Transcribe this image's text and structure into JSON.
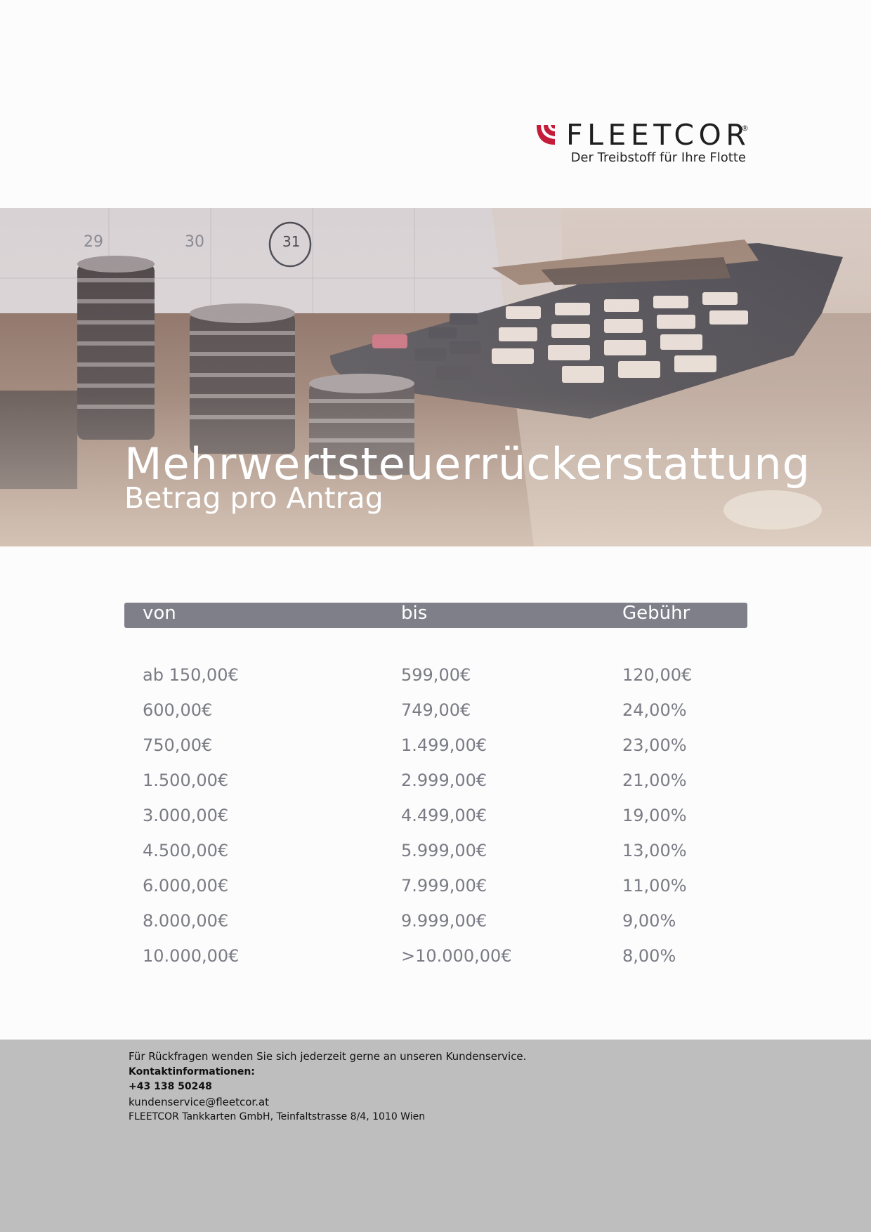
{
  "brand": {
    "name": "FLEETCOR",
    "registered_mark": "®",
    "tagline": "Der Treibstoff für Ihre Flotte",
    "accent_color": "#c31d3a"
  },
  "hero": {
    "title": "Mehrwertsteuerrückerstattung",
    "subtitle": "Betrag pro Antrag",
    "calendar_numbers": [
      "29",
      "30",
      "31"
    ]
  },
  "table": {
    "headers": {
      "from": "von",
      "to": "bis",
      "fee": "Gebühr"
    },
    "header_color": "#7e7f89",
    "rows": [
      {
        "from": "ab 150,00€",
        "to": "599,00€",
        "fee": "120,00€"
      },
      {
        "from": "600,00€",
        "to": "749,00€",
        "fee": "24,00%"
      },
      {
        "from": "750,00€",
        "to": "1.499,00€",
        "fee": "23,00%"
      },
      {
        "from": "1.500,00€",
        "to": "2.999,00€",
        "fee": "21,00%"
      },
      {
        "from": "3.000,00€",
        "to": "4.499,00€",
        "fee": "19,00%"
      },
      {
        "from": "4.500,00€",
        "to": "5.999,00€",
        "fee": "13,00%"
      },
      {
        "from": "6.000,00€",
        "to": "7.999,00€",
        "fee": "11,00%"
      },
      {
        "from": "8.000,00€",
        "to": "9.999,00€",
        "fee": "9,00%"
      },
      {
        "from": "10.000,00€",
        "to": ">10.000,00€",
        "fee": "8,00%"
      }
    ]
  },
  "footer": {
    "intro": "Für Rückfragen wenden Sie sich jederzeit gerne an unseren Kundenservice.",
    "contact_heading": "Kontaktinformationen:",
    "phone": "+43 138 50248",
    "email": "kundenservice@fleetcor.at",
    "address": "FLEETCOR Tankkarten GmbH, Teinfaltstrasse 8/4, 1010 Wien",
    "background_color": "#bebebe"
  }
}
